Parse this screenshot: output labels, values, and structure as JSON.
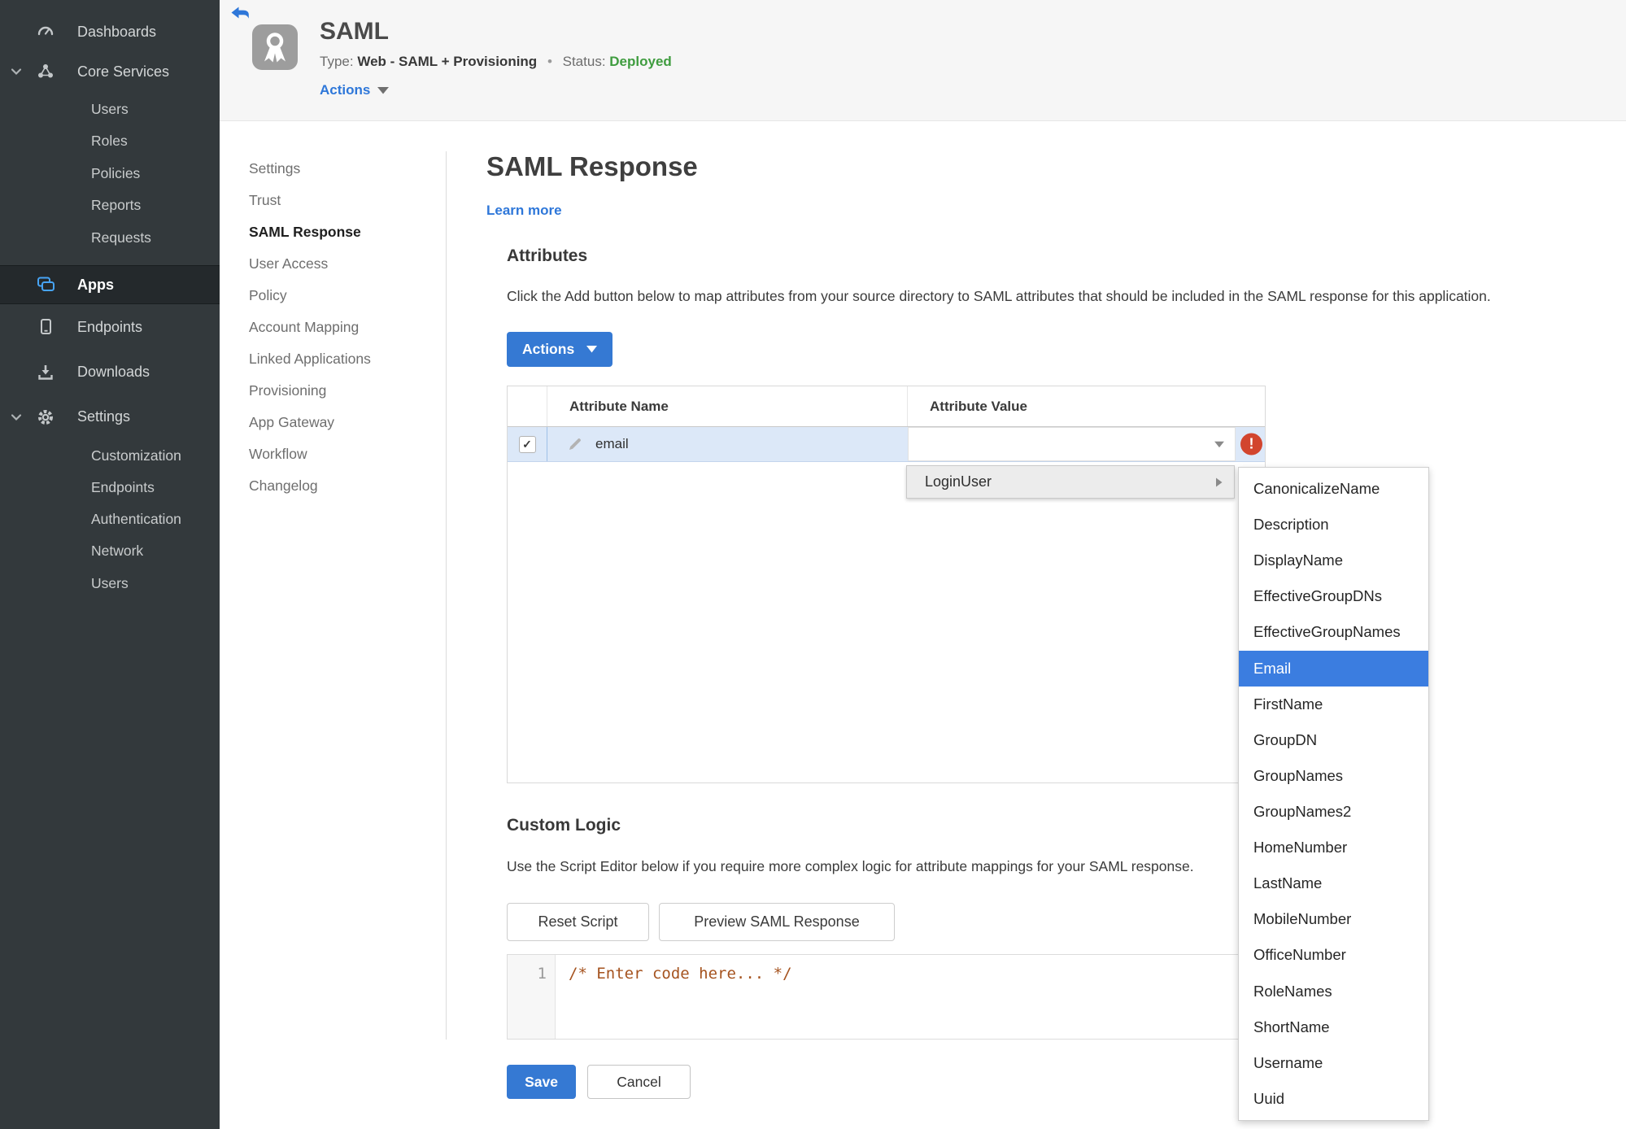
{
  "colors": {
    "accent_blue": "#3579d3",
    "link_blue": "#2e77d9",
    "selection_blue": "#3b7de0",
    "status_green": "#3f9c3f",
    "error_red": "#d2452e",
    "row_highlight": "#dce8f8",
    "sidebar_bg": "#33393c",
    "sidebar_selected_bg": "#24292c"
  },
  "sidebar": {
    "dashboards": "Dashboards",
    "core_services": "Core Services",
    "core_items": [
      "Users",
      "Roles",
      "Policies",
      "Reports",
      "Requests"
    ],
    "apps": "Apps",
    "endpoints": "Endpoints",
    "downloads": "Downloads",
    "settings": "Settings",
    "settings_items": [
      "Customization",
      "Endpoints",
      "Authentication",
      "Network",
      "Users"
    ]
  },
  "header": {
    "title": "SAML",
    "type_label": "Type:",
    "type_value": "Web - SAML + Provisioning",
    "separator": "•",
    "status_label": "Status:",
    "status_value": "Deployed",
    "actions_label": "Actions"
  },
  "subnav": {
    "items": [
      "Settings",
      "Trust",
      "SAML Response",
      "User Access",
      "Policy",
      "Account Mapping",
      "Linked Applications",
      "Provisioning",
      "App Gateway",
      "Workflow",
      "Changelog"
    ],
    "active": "SAML Response"
  },
  "main": {
    "title": "SAML Response",
    "learn_more": "Learn more",
    "attributes": {
      "heading": "Attributes",
      "description": "Click the Add button below to map attributes from your source directory to SAML attributes that should be included in the SAML response for this application.",
      "actions_button": "Actions",
      "columns": [
        "Attribute Name",
        "Attribute Value"
      ],
      "row": {
        "name": "email",
        "value": "",
        "checked": true,
        "error_icon": "!"
      }
    },
    "context_menu": {
      "label": "LoginUser"
    },
    "submenu": {
      "items": [
        "CanonicalizeName",
        "Description",
        "DisplayName",
        "EffectiveGroupDNs",
        "EffectiveGroupNames",
        "Email",
        "FirstName",
        "GroupDN",
        "GroupNames",
        "GroupNames2",
        "HomeNumber",
        "LastName",
        "MobileNumber",
        "OfficeNumber",
        "RoleNames",
        "ShortName",
        "Username",
        "Uuid"
      ],
      "selected": "Email"
    },
    "custom_logic": {
      "heading": "Custom Logic",
      "description": "Use the Script Editor below if you require more complex logic for attribute mappings for your SAML response.",
      "reset_button": "Reset Script",
      "preview_button": "Preview SAML Response",
      "editor": {
        "line_number": "1",
        "code": "/* Enter code here... */"
      }
    },
    "footer": {
      "save": "Save",
      "cancel": "Cancel"
    }
  }
}
